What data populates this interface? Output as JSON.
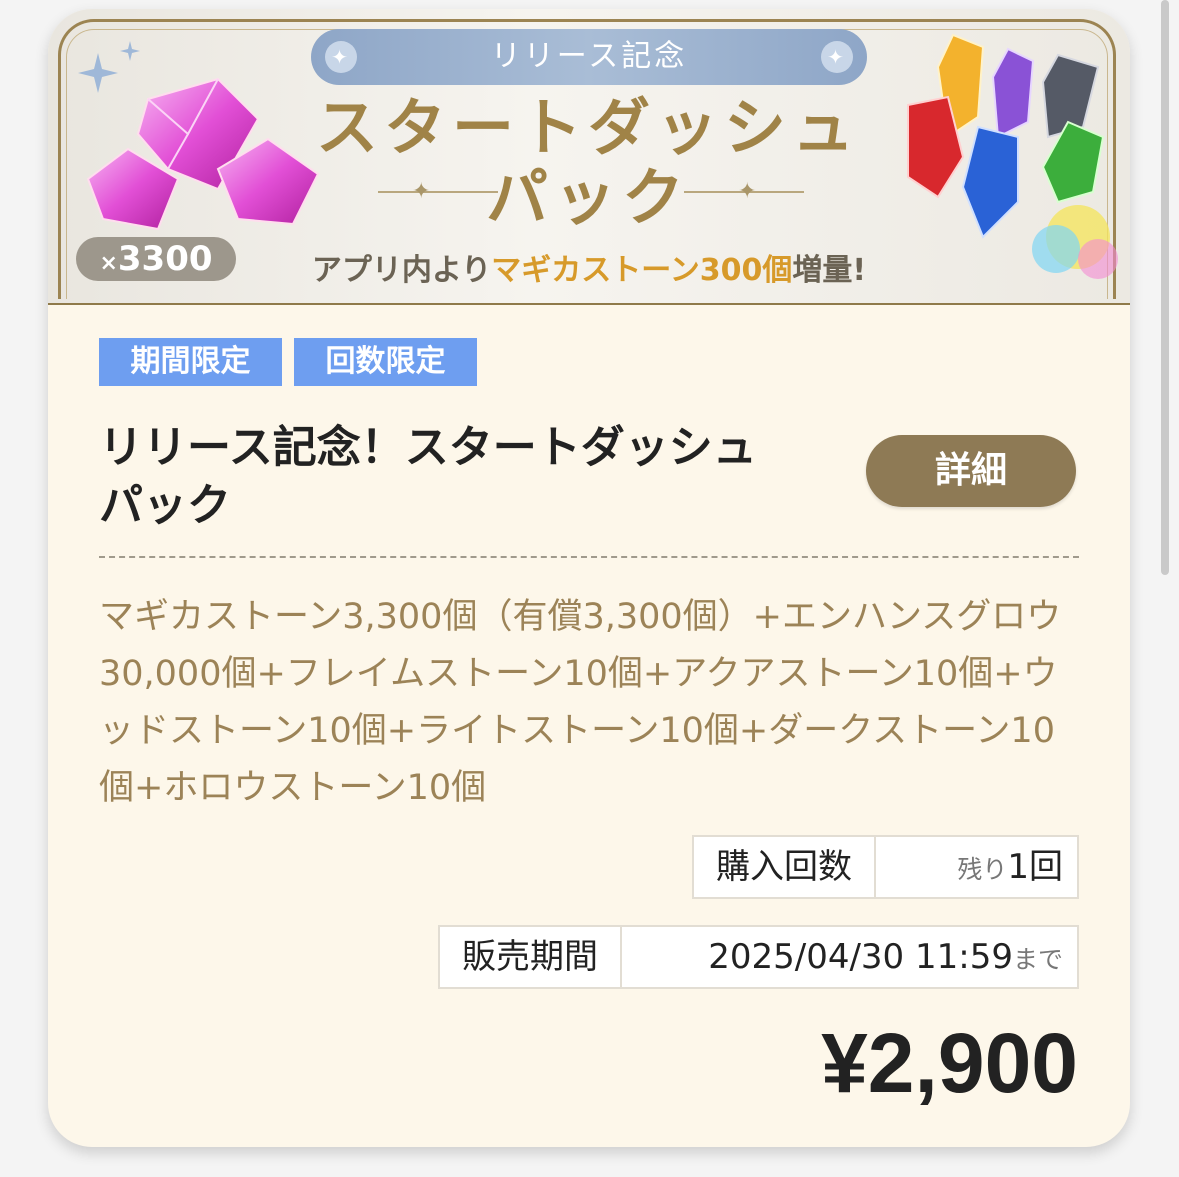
{
  "banner": {
    "ribbon": "リリース記念",
    "title_line1": "スタートダッシュ",
    "title_line2": "パック",
    "promo_prefix": "アプリ内より",
    "promo_highlight": "マギカストーン300個",
    "promo_suffix": "増量!",
    "quantity_x": "×",
    "quantity": "3300"
  },
  "tags": [
    "期間限定",
    "回数限定"
  ],
  "pack": {
    "title_line1": "リリース記念！スタートダッシュ",
    "title_line2": "パック",
    "detail_label": "詳細",
    "contents": "マギカストーン3,300個（有償3,300個）+エンハンスグロウ30,000個+フレイムストーン10個+アクアストーン10個+ウッドストーン10個+ライトストーン10個+ダークストーン10個+ホロウストーン10個"
  },
  "purchase": {
    "label": "購入回数",
    "value_prefix": "残り",
    "value": "1回"
  },
  "sale_period": {
    "label": "販売期間",
    "value": "2025/04/30 11:59",
    "suffix": "まで"
  },
  "price": "¥2,900",
  "colors": {
    "tag": "#6e9ef0",
    "detail_button": "#8e7a55",
    "contents_text": "#9c8357",
    "promo_highlight": "#d79a2a",
    "card_bg": "#fdf7ea"
  },
  "icons": [
    "pink-gem-icon",
    "elemental-crystals-icon",
    "sparkle-icon"
  ]
}
